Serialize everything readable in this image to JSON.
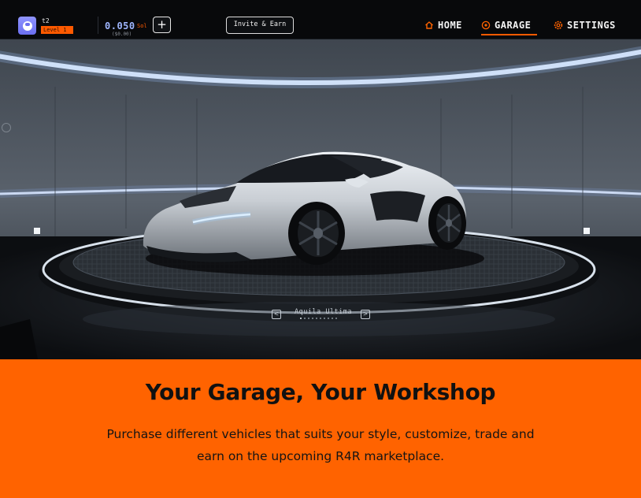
{
  "header": {
    "username": "t2",
    "level_badge": "Level 1",
    "balance": "0.050",
    "balance_unit": "Sol",
    "balance_usd": "($0.00)",
    "add_label": "+",
    "invite_label": "Invite & Earn"
  },
  "nav": {
    "home": "HOME",
    "garage": "GARAGE",
    "settings": "SETTINGS",
    "active": "GARAGE"
  },
  "showroom": {
    "car_name": "Aquila Ultima",
    "prev_label": "<",
    "next_label": ">",
    "carousel_count": 10,
    "carousel_index": 0
  },
  "banner": {
    "title": "Your Garage, Your Workshop",
    "description": "Purchase different vehicles that suits your style, customize, trade and earn on the upcoming R4R marketplace."
  },
  "colors": {
    "accent": "#ff6300",
    "balance": "#9fb6ff",
    "avatar": "#7a7ef7"
  },
  "icons": {
    "home": "home-icon",
    "garage": "garage-icon",
    "settings": "gear-icon"
  }
}
